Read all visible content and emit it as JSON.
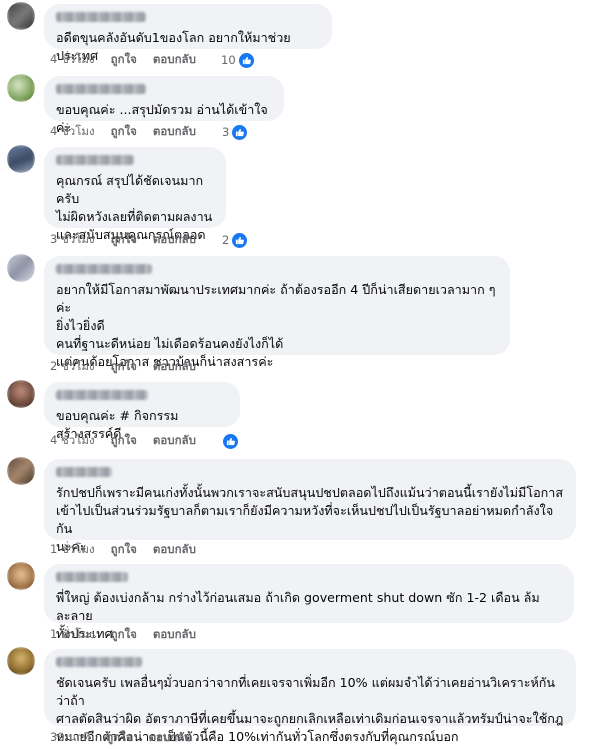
{
  "labels": {
    "like": "ถูกใจ",
    "reply": "ตอบกลับ"
  },
  "colors": {
    "bubble": "#f0f2f5",
    "meta_text": "#65676b",
    "like_blue": "#1877f2"
  },
  "icons": {
    "reaction": "like-icon"
  },
  "comments": [
    {
      "text": "อดีตขุนคลังอันดับ1ของโลก อยากให้มาช่วยประเทศ",
      "time": "4 ชั่วโมง",
      "reactions": "10"
    },
    {
      "text": "ขอบคุณค่ะ ...สรุปมัดรวม อ่านได้เข้าใจค่ะ",
      "time": "4 ชั่วโมง",
      "reactions": "3"
    },
    {
      "text": "คุณกรณ์ สรุปได้ชัดเจนมากครับ\nไม่ผิดหวังเลยที่ติดตามผลงาน\nและสนับสนุนคุณกรณ์ตลอด",
      "time": "3 ชั่วโมง",
      "reactions": "2"
    },
    {
      "text": "อยากให้มีโอกาสมาพัฒนาประเทศมากค่ะ ถ้าต้องรออีก 4 ปีก็น่าเสียดายเวลามาก ๆ ค่ะ\nยิ่งไวยิ่งดี\nคนที่ฐานะดีหน่อย ไม่เดือดร้อนคงยังไงก็ได้\nแต่คนด้อยโอกาส ชาวบ้านก็น่าสงสารค่ะ",
      "time": "2 ชั่วโมง",
      "reactions": ""
    },
    {
      "text": "ขอบคุณค่ะ # กิจกรรม สร้างสรรค์ดี",
      "time": "4 ชั่วโมง",
      "reactions": ""
    },
    {
      "text": "รักปชปก็เพราะมีคนเก่งทั้งนั้นพวกเราจะสนับสนุนปชปตลอดไปถึงแม้นว่าตอนนี้เรายังไม่มีโอกาส\nเข้าไปเป็นส่วนร่วมรัฐบาลก็ตามเราก็ยังมีความหวังที่จะเห็นปชปไปเป็นรัฐบาลอย่าหมดกำลังใจกัน\nนะคะ",
      "time": "1 ชั่วโมง",
      "reactions": ""
    },
    {
      "text": "พี่ใหญ่ ต้องเบ่งกล้าม กร่างไว้ก่อนเสมอ ถ้าเกิด goverment shut down ซัก 1-2 เดือน ล้มละลาย\nทั้งประเทศ",
      "time": "1 ชั่วโมง",
      "reactions": ""
    },
    {
      "text": "ชัดเจนครับ เพลอื่นๆมั่วบอกว่าจากที่เคยเจรจาเพิ่มอีก 10% แต่ผมจำได้ว่าเคยอ่านวิเคราะห์กันว่าถ้า\nศาลตัดสินว่าผิด อัตราภาษีที่เคยขึ้นมาจะถูกยกเลิกเหลือเท่าเดิมก่อนเจรจาแล้วทรัมป์น่าจะใช้กฎ\nหมายอีกตัวคือน่าจะเป็นตัวนี้คือ 10%เท่ากันทั่วโลกซึ่งตรงกับที่คุณกรณ์บอก",
      "time": "39 นาที",
      "reactions": ""
    }
  ]
}
